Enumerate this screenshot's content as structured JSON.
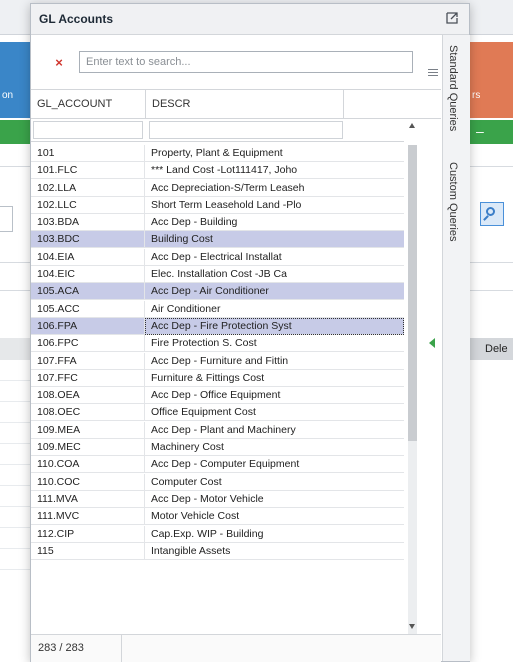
{
  "background": {
    "left_tile_text": "on",
    "right_tile_text": "rs",
    "right_green_text": "–",
    "dele_label": "Dele"
  },
  "dialog": {
    "title": "GL Accounts",
    "search_placeholder": "Enter text to search...",
    "search_value": "",
    "clear_label": "×",
    "columns": [
      "GL_ACCOUNT",
      "DESCR"
    ],
    "rows": [
      {
        "account": "101",
        "descr": "Property, Plant & Equipment"
      },
      {
        "account": "101.FLC",
        "descr": "*** Land Cost -Lot111417, Joho"
      },
      {
        "account": "102.LLA",
        "descr": "Acc Depreciation-S/Term Leaseh"
      },
      {
        "account": "102.LLC",
        "descr": "Short Term Leasehold Land -Plo"
      },
      {
        "account": "103.BDA",
        "descr": "Acc Dep - Building"
      },
      {
        "account": "103.BDC",
        "descr": "Building Cost"
      },
      {
        "account": "104.EIA",
        "descr": "Acc Dep - Electrical Installat"
      },
      {
        "account": "104.EIC",
        "descr": "Elec. Installation Cost -JB Ca"
      },
      {
        "account": "105.ACA",
        "descr": "Acc Dep - Air Conditioner"
      },
      {
        "account": "105.ACC",
        "descr": " Air Conditioner"
      },
      {
        "account": "106.FPA",
        "descr": "Acc Dep - Fire Protection Syst"
      },
      {
        "account": "106.FPC",
        "descr": "Fire Protection S. Cost"
      },
      {
        "account": "107.FFA",
        "descr": "Acc Dep - Furniture and Fittin"
      },
      {
        "account": "107.FFC",
        "descr": "Furniture & Fittings Cost"
      },
      {
        "account": "108.OEA",
        "descr": "Acc Dep - Office Equipment"
      },
      {
        "account": "108.OEC",
        "descr": "Office Equipment Cost"
      },
      {
        "account": "109.MEA",
        "descr": "Acc Dep - Plant and Machinery"
      },
      {
        "account": "109.MEC",
        "descr": "Machinery Cost"
      },
      {
        "account": "110.COA",
        "descr": "Acc Dep - Computer Equipment"
      },
      {
        "account": "110.COC",
        "descr": "Computer Cost"
      },
      {
        "account": "111.MVA",
        "descr": "Acc Dep - Motor Vehicle"
      },
      {
        "account": "111.MVC",
        "descr": "Motor Vehicle Cost"
      },
      {
        "account": "112.CIP",
        "descr": "Cap.Exp. WIP - Building"
      },
      {
        "account": "115",
        "descr": "Intangible Assets"
      }
    ],
    "selected_rows": [
      "103.BDC",
      "105.ACA",
      "106.FPA"
    ],
    "focused_row": "106.FPA",
    "record_count": "283 / 283",
    "side_tabs": [
      "Standard Queries",
      "Custom Queries"
    ]
  },
  "colors": {
    "selected_row": "#c7cbe7",
    "accent_green": "#3aa34a",
    "clear_red": "#d0352d"
  }
}
